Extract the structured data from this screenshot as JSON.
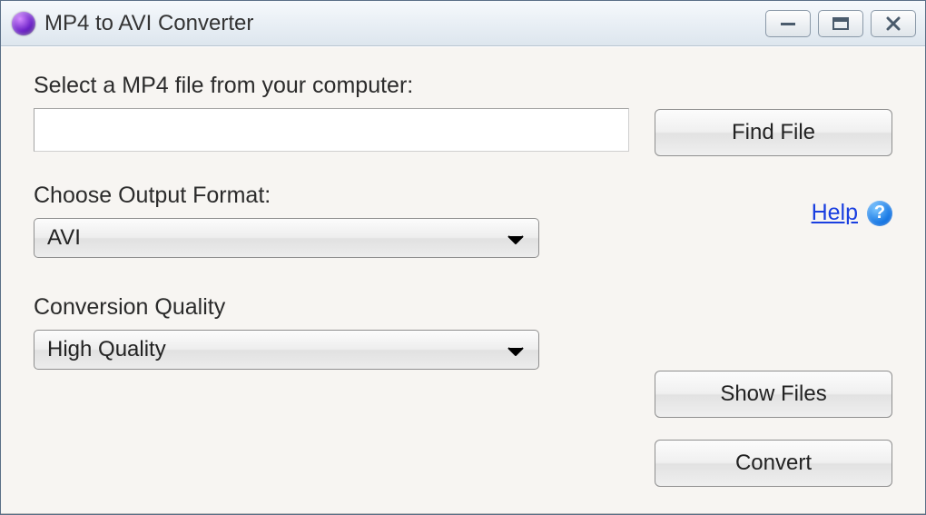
{
  "window": {
    "title": "MP4 to AVI Converter"
  },
  "labels": {
    "select_file": "Select a MP4 file from your computer:",
    "output_format": "Choose Output Format:",
    "conversion_quality": "Conversion Quality"
  },
  "inputs": {
    "file_path": ""
  },
  "selects": {
    "output_format": "AVI",
    "quality": "High Quality"
  },
  "buttons": {
    "find_file": "Find File",
    "show_files": "Show Files",
    "convert": "Convert"
  },
  "help": {
    "link_text": "Help",
    "icon_glyph": "?"
  }
}
